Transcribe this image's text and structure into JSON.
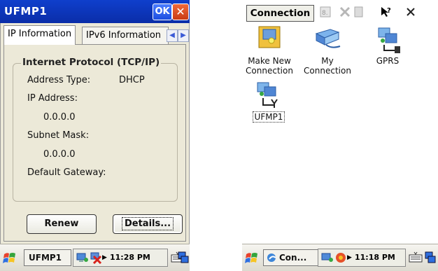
{
  "left": {
    "title": "UFMP1",
    "ok_label": "OK",
    "tabs": [
      {
        "label": "IP Information"
      },
      {
        "label": "IPv6 Information"
      }
    ],
    "group_title": "Internet Protocol (TCP/IP)",
    "address_type_label": "Address Type:",
    "address_type_value": "DHCP",
    "ip_address_label": "IP Address:",
    "ip_address_value": "0.0.0.0",
    "subnet_mask_label": "Subnet Mask:",
    "subnet_mask_value": "0.0.0.0",
    "default_gateway_label": "Default Gateway:",
    "renew_label": "Renew",
    "details_label": "Details...",
    "taskbar": {
      "task_label": "UFMP1",
      "time": "11:28 PM"
    }
  },
  "right": {
    "title": "Connection",
    "items": [
      {
        "label": "Make New Connection",
        "line1": "Make New",
        "line2": "Connection"
      },
      {
        "label": "My Connection",
        "line1": "My",
        "line2": "Connection"
      },
      {
        "label": "GPRS",
        "line1": "GPRS",
        "line2": ""
      },
      {
        "label": "UFMP1",
        "line1": "UFMP1",
        "line2": ""
      }
    ],
    "taskbar": {
      "task_label": "Con...",
      "time": "11:18 PM"
    }
  },
  "colors": {
    "title_bar": "#0a2da8",
    "dialog_bg": "#ece9d8",
    "close_red": "#c93b14"
  }
}
